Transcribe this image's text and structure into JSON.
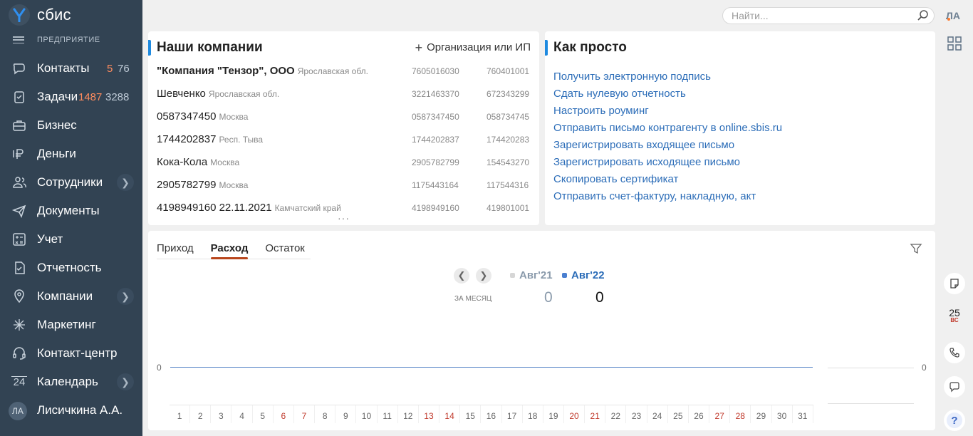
{
  "app": {
    "brand": "сбис",
    "company_label": "ПРЕДПРИЯТИЕ",
    "accent_color": "#1e8ae0"
  },
  "sidebar": {
    "items": [
      {
        "label": "Контакты",
        "icon": "chat-icon",
        "count_a": "5",
        "count_b": "76"
      },
      {
        "label": "Задачи",
        "icon": "tasks-icon",
        "count_a": "1487",
        "count_b": "3288"
      },
      {
        "label": "Бизнес",
        "icon": "business-icon"
      },
      {
        "label": "Деньги",
        "icon": "money-icon"
      },
      {
        "label": "Сотрудники",
        "icon": "employees-icon",
        "has_submenu": true
      },
      {
        "label": "Документы",
        "icon": "paper-plane-icon"
      },
      {
        "label": "Учет",
        "icon": "calculator-icon"
      },
      {
        "label": "Отчетность",
        "icon": "report-icon"
      },
      {
        "label": "Компании",
        "icon": "location-icon",
        "has_submenu": true
      },
      {
        "label": "Маркетинг",
        "icon": "sparkle-icon"
      },
      {
        "label": "Контакт-центр",
        "icon": "headset-icon"
      },
      {
        "label": "Календарь",
        "icon": "calendar-icon",
        "calendar_day": "24",
        "has_submenu": true
      },
      {
        "label": "Лисичкина А.А.",
        "avatar": "ЛА"
      }
    ]
  },
  "topbar": {
    "search_placeholder": "Найти...",
    "user_initials": "ЛА"
  },
  "companies": {
    "title": "Наши компании",
    "add_label": "Организация или ИП",
    "rows": [
      {
        "name": "\"Компания \"Тензор\", ООО",
        "region": "Ярославская обл.",
        "inn": "7605016030",
        "kpp": "760401001",
        "bold": true
      },
      {
        "name": "Шевченко",
        "region": "Ярославская обл.",
        "inn": "3221463370",
        "kpp": "672343299"
      },
      {
        "name": "0587347450",
        "region": "Москва",
        "inn": "0587347450",
        "kpp": "058734745"
      },
      {
        "name": "1744202837",
        "region": "Респ. Тыва",
        "inn": "1744202837",
        "kpp": "174420283"
      },
      {
        "name": "Кока-Кола",
        "region": "Москва",
        "inn": "2905782799",
        "kpp": "154543270"
      },
      {
        "name": "2905782799",
        "region": "Москва",
        "inn": "1175443164",
        "kpp": "117544316"
      },
      {
        "name": "4198949160 22.11.2021",
        "region": "Камчатский край",
        "inn": "4198949160",
        "kpp": "419801001"
      }
    ],
    "more": "···"
  },
  "howto": {
    "title": "Как просто",
    "links": [
      "Получить электронную подпись",
      "Сдать нулевую отчетность",
      "Настроить роуминг",
      "Отправить письмо контрагенту в online.sbis.ru",
      "Зарегистрировать входящее письмо",
      "Зарегистрировать исходящее письмо",
      "Скопировать сертификат",
      "Отправить счет-фактуру, накладную, акт"
    ]
  },
  "finance": {
    "tabs": [
      "Приход",
      "Расход",
      "Остаток"
    ],
    "active_tab": "Расход",
    "period_label": "ЗА МЕСЯЦ",
    "legend": [
      {
        "label": "Авг'21",
        "color": "#d6d6d6",
        "total": "0"
      },
      {
        "label": "Авг'22",
        "color": "#4a7fd0",
        "total": "0"
      }
    ],
    "axis_zero_left": "0",
    "axis_zero_right": "0",
    "days": [
      "1",
      "2",
      "3",
      "4",
      "5",
      "6",
      "7",
      "8",
      "9",
      "10",
      "11",
      "12",
      "13",
      "14",
      "15",
      "16",
      "17",
      "18",
      "19",
      "20",
      "21",
      "22",
      "23",
      "24",
      "25",
      "26",
      "27",
      "28",
      "29",
      "30",
      "31"
    ],
    "weekend_days": [
      "6",
      "7",
      "13",
      "14",
      "20",
      "21",
      "27",
      "28"
    ]
  },
  "rail": {
    "date_num": "25",
    "date_dow": "ВС",
    "help": "?"
  }
}
